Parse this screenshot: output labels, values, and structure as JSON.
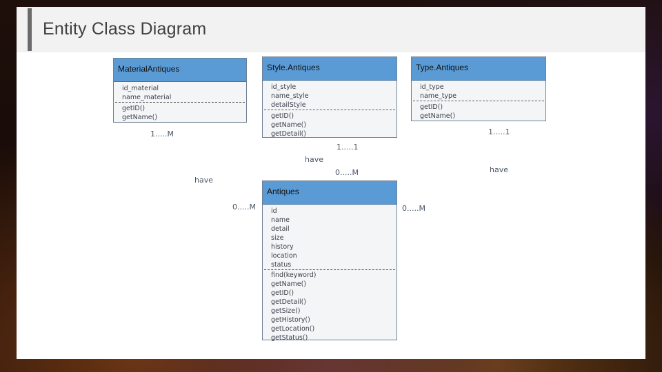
{
  "slide": {
    "title": "Entity Class Diagram"
  },
  "classes": {
    "material": {
      "name": "MaterialAntiques",
      "attributes": [
        "id_material",
        "name_material"
      ],
      "methods": [
        "getID()",
        "getName()"
      ]
    },
    "style": {
      "name": "Style.Antiques",
      "attributes": [
        "id_style",
        "name_style",
        "detailStyle"
      ],
      "methods": [
        "getID()",
        "getName()",
        "getDetail()"
      ]
    },
    "type": {
      "name": "Type.Antiques",
      "attributes": [
        "id_type",
        "name_type"
      ],
      "methods": [
        "getID()",
        "getName()"
      ]
    },
    "antiques": {
      "name": "Antiques",
      "attributes": [
        "id",
        "name",
        "detail",
        "size",
        "history",
        "location",
        "status"
      ],
      "methods": [
        "find(keyword)",
        "getName()",
        "getID()",
        "getDetail()",
        "getSize()",
        "getHistory()",
        "getLocation()",
        "getStatus()"
      ]
    }
  },
  "relations": {
    "material_mult": "1.....M",
    "material_verb": "have",
    "material_antiques_mult": "0.....M",
    "style_mult": "1.....1",
    "style_verb": "have",
    "style_antiques_mult": "0.....M",
    "type_mult": "1.....1",
    "type_verb": "have",
    "type_antiques_mult": "0.....M"
  },
  "colors": {
    "class_header": "#5b9bd5",
    "class_body": "#f4f5f7",
    "title_bar": "#f2f2f2",
    "title_accent": "#6b6b6b"
  }
}
